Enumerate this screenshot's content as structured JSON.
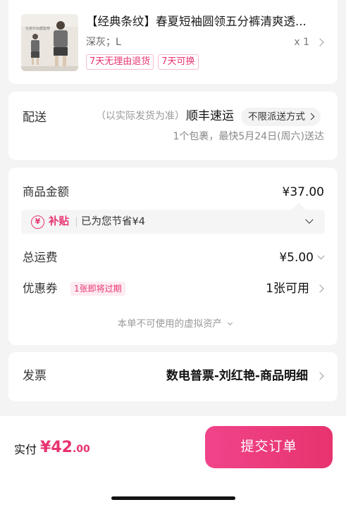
{
  "product": {
    "title": "【经典条纹】春夏短袖圆领五分裤清爽透...",
    "variant": "深灰；L",
    "quantity": "x 1",
    "image_caption": "在家外出都能穿",
    "tags": [
      "7天无理由退货",
      "7天可换"
    ]
  },
  "delivery": {
    "label": "配送",
    "note": "（以实际发货为准）",
    "carrier": "顺丰速运",
    "method": "不限派送方式",
    "eta": "1个包裹，最快5月24日(周六)送达"
  },
  "pricing": {
    "goods_label": "商品金额",
    "goods_value": "¥37.00",
    "subsidy_icon": "¥",
    "subsidy_label": "补贴",
    "subsidy_text": "已为您节省¥4",
    "shipping_label": "总运费",
    "shipping_value": "¥5.00",
    "coupon_label": "优惠券",
    "coupon_tag": "1张即将过期",
    "coupon_value": "1张可用",
    "assets_note": "本单不可使用的虚拟资产"
  },
  "invoice": {
    "label": "发票",
    "value": "数电普票-刘红艳-商品明细"
  },
  "footer": {
    "pay_label": "实付",
    "pay_symbol": "¥",
    "pay_int": "42",
    "pay_dec": ".00",
    "submit_label": "提交订单"
  },
  "colors": {
    "accent": "#e8336f",
    "background": "#f4f4f4"
  }
}
